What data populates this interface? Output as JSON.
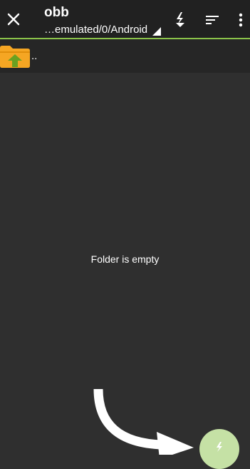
{
  "header": {
    "title": "obb",
    "path": "…emulated/0/Android",
    "icons": {
      "close": "close-icon",
      "dropdown": "caret-down-icon",
      "download": "lightning-download-icon",
      "sort": "sort-icon",
      "more": "more-vertical-icon"
    }
  },
  "list": {
    "parent_label": "..",
    "parent_icon": "folder-up-icon"
  },
  "content": {
    "empty_message": "Folder is empty"
  },
  "fab": {
    "icon": "lightning-download-icon"
  },
  "colors": {
    "appbar": "#212121",
    "accent": "#8bc34a",
    "background": "#2f2f2f",
    "folder": "#f5a623",
    "fab": "#c5e1a5"
  }
}
